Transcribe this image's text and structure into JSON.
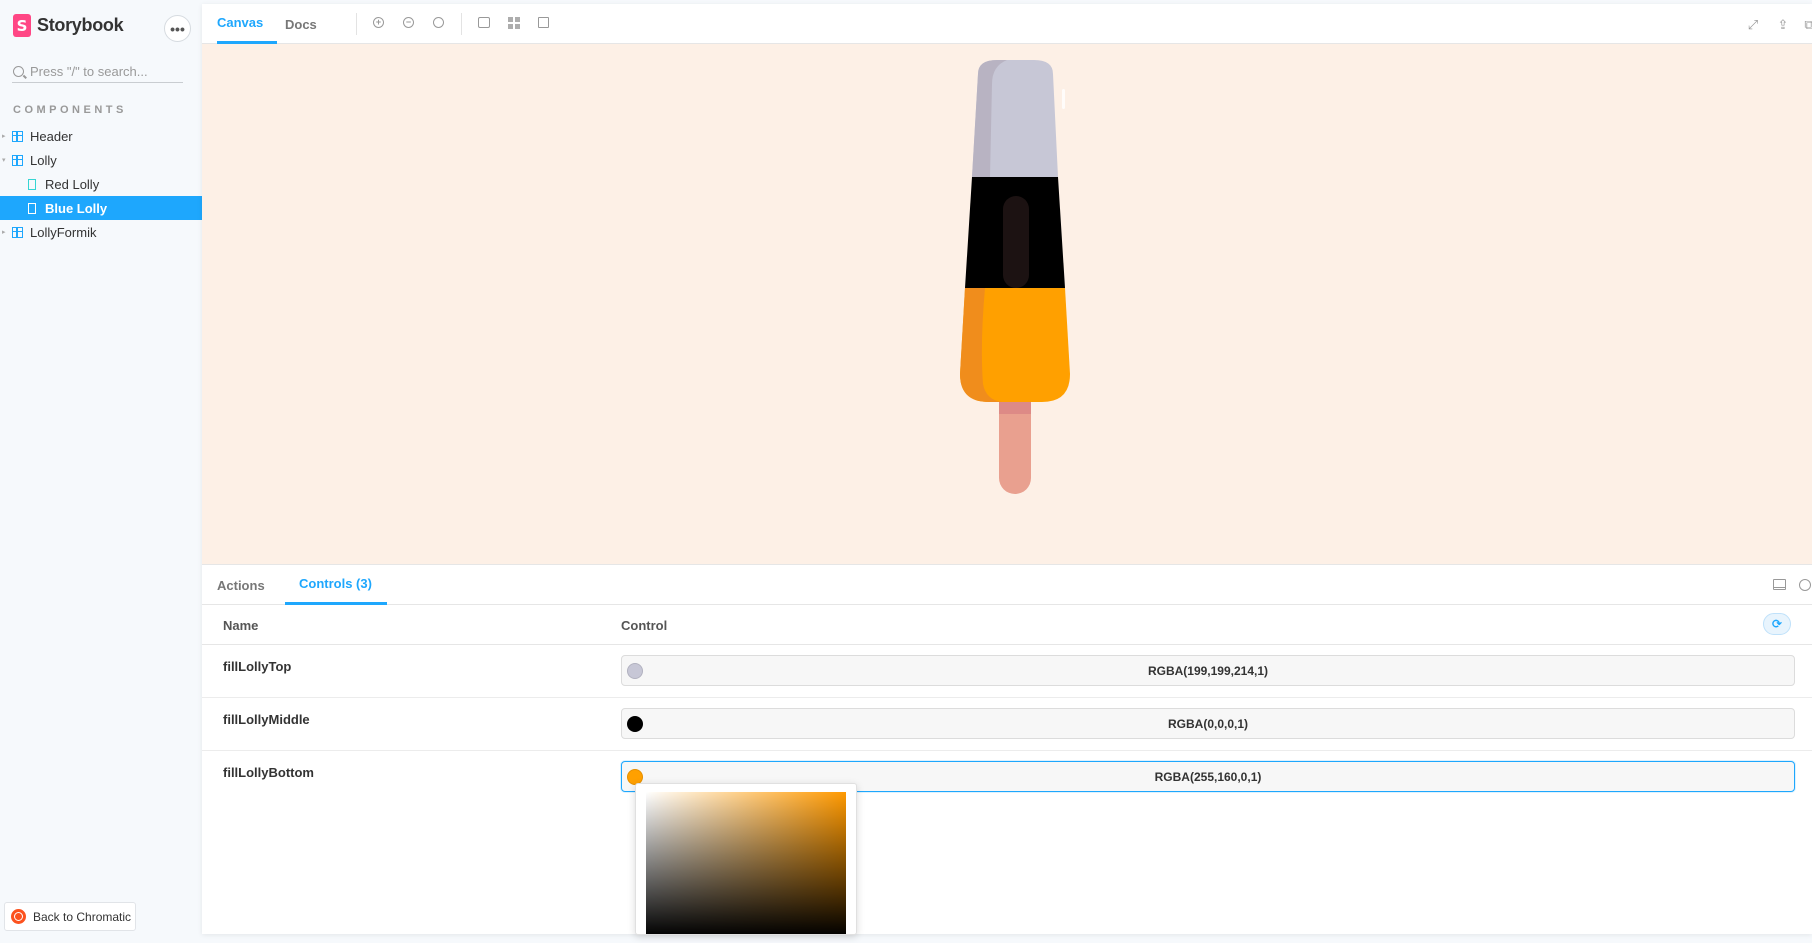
{
  "app": {
    "brand_name": "Storybook",
    "brand_glyph": "S",
    "menu_glyph": "•••"
  },
  "search": {
    "placeholder": "Press \"/\" to search..."
  },
  "sidebar": {
    "section_label": "COMPONENTS",
    "items": [
      {
        "label": "Header",
        "type": "component"
      },
      {
        "label": "Lolly",
        "type": "component"
      },
      {
        "label": "Red Lolly",
        "type": "story"
      },
      {
        "label": "Blue Lolly",
        "type": "story",
        "selected": true
      },
      {
        "label": "LollyFormik",
        "type": "component"
      }
    ],
    "back_label": "Back to Chromatic"
  },
  "toolbar": {
    "tabs": [
      {
        "label": "Canvas",
        "active": true
      },
      {
        "label": "Docs",
        "active": false
      }
    ],
    "icons": [
      "zoom-in-icon",
      "zoom-out-icon",
      "zoom-reset-icon",
      "background-icon",
      "grid-icon",
      "outline-icon",
      "fullscreen-icon",
      "share-icon",
      "open-new-tab-icon"
    ]
  },
  "addons": {
    "tabs": [
      {
        "label": "Actions",
        "active": false
      },
      {
        "label": "Controls (3)",
        "active": true
      }
    ],
    "table_head": {
      "name": "Name",
      "control": "Control"
    },
    "rows": [
      {
        "name": "fillLollyTop",
        "value": "RGBA(199,199,214,1)",
        "swatch": "#c7c7d6"
      },
      {
        "name": "fillLollyMiddle",
        "value": "RGBA(0,0,0,1)",
        "swatch": "#000000"
      },
      {
        "name": "fillLollyBottom",
        "value": "RGBA(255,160,0,1)",
        "swatch": "#ffa000"
      }
    ]
  },
  "colors": {
    "accent": "#1ea7fd",
    "brand": "#ff4785",
    "canvas_bg": "#fdf0e6",
    "lolly_top": "#c7c7d6",
    "lolly_middle": "#000000",
    "lolly_bottom": "#ffa000",
    "lolly_stick": "#e9a08f"
  }
}
